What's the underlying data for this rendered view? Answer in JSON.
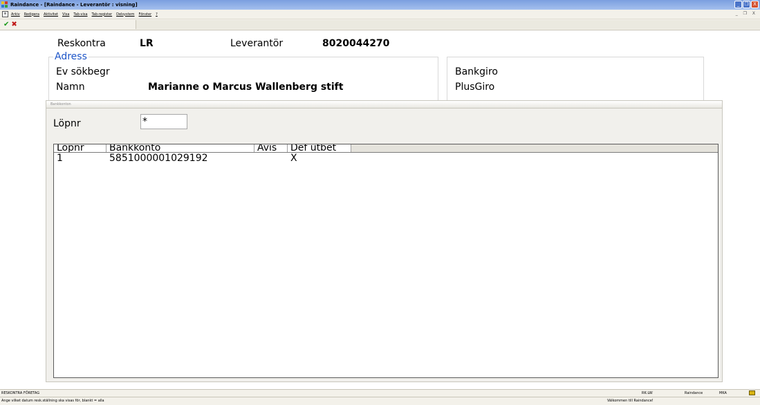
{
  "window": {
    "title": "Raindance - [Raindance - Leverantör : visning]",
    "btn_min": "_",
    "btn_restore": "❐",
    "btn_close": "X",
    "mdi_controls": "_ ❐ X"
  },
  "menu": {
    "items": [
      "Arkiv",
      "Redigera",
      "Aktivitet",
      "Visa",
      "Tab-visa",
      "Tab-register",
      "Delsystem",
      "Fönster",
      "?"
    ]
  },
  "toolbar": {
    "accept_icon": "✔",
    "cancel_icon": "✖"
  },
  "form": {
    "reskontra_label": "Reskontra",
    "reskontra_value": "LR",
    "leverantor_label": "Leverantör",
    "leverantor_value": "8020044270",
    "address_legend": "Adress",
    "sokbegr_label": "Ev sökbegr",
    "namn_label": "Namn",
    "namn_value": "Marianne o Marcus Wallenberg stift",
    "bankgiro_label": "Bankgiro",
    "plusgiro_label": "PlusGiro"
  },
  "popup": {
    "title": "Bankkonton",
    "lopnr_label": "Löpnr",
    "lopnr_value": "*",
    "columns": [
      "Löpnr",
      "Bankkonto",
      "Avis",
      "Def utbet"
    ],
    "rows": [
      {
        "lopnr": "1",
        "bankkonto": "5851000001029192",
        "avis": "",
        "def_utbet": "X"
      }
    ]
  },
  "status": {
    "module": "RESKONTRA FÖRETAG",
    "code": "RK:LW",
    "app": "Raindance",
    "user": "MKA",
    "hint": "Ange vilket datum resk.ställning ska visas för, blankt = alla",
    "welcome": "Välkommen till Raindance!"
  },
  "colors": {
    "legend": "#1e56c8",
    "accept": "#1a9a1a",
    "cancel": "#c01818"
  }
}
